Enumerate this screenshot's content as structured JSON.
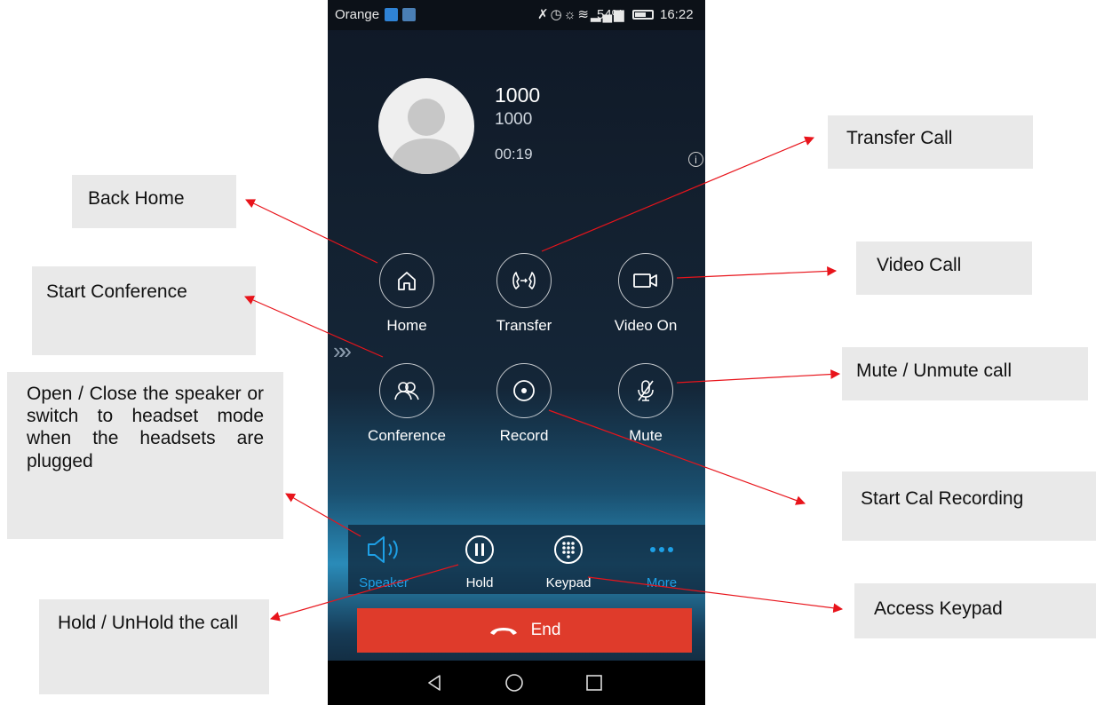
{
  "status_bar": {
    "carrier": "Orange",
    "battery": "54%",
    "time": "16:22",
    "icons": [
      "bluetooth-icon",
      "alarm-icon",
      "eye-comfort-icon",
      "wifi-icon",
      "signal-icon",
      "battery-icon"
    ]
  },
  "call": {
    "name": "1000",
    "number": "1000",
    "duration": "00:19",
    "info_icon": "i"
  },
  "actions": {
    "home": "Home",
    "transfer": "Transfer",
    "video": "Video On",
    "conference": "Conference",
    "record": "Record",
    "mute": "Mute"
  },
  "bottom_bar": {
    "speaker": "Speaker",
    "hold": "Hold",
    "keypad": "Keypad",
    "more": "More"
  },
  "end_label": "End",
  "callouts": {
    "transfer": "Transfer Call",
    "back_home": "Back Home",
    "video": "Video Call",
    "conference": "Start Conference",
    "mute": "Mute / Unmute call",
    "speaker": "Open / Close the speaker or switch to headset mode when the headsets are plugged",
    "record": "Start Cal Recording",
    "keypad": "Access Keypad",
    "hold": "Hold / UnHold the call"
  },
  "colors": {
    "accent_blue": "#1ea0e6",
    "end_red": "#df3b2b",
    "arrow_red": "#e8141b",
    "callout_bg": "#e9e9e9"
  }
}
